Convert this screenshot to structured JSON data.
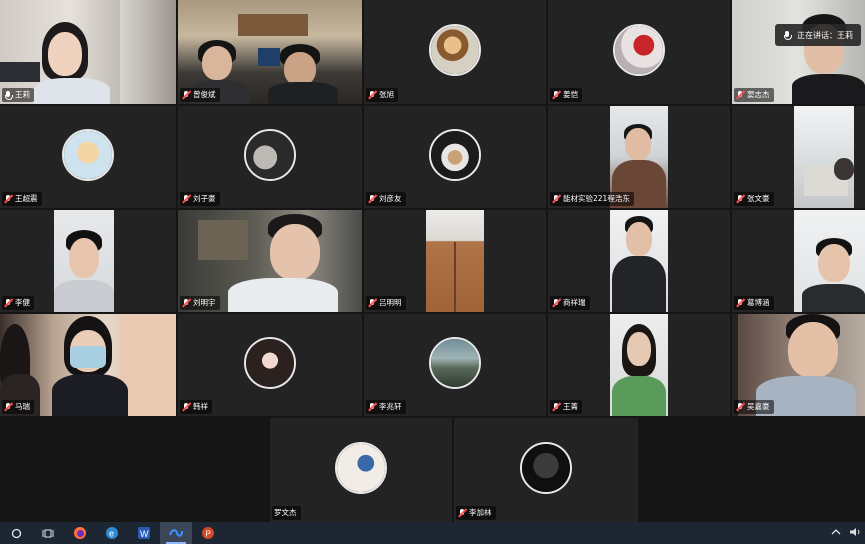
{
  "meeting": {
    "talking_banner": "正在讲话：王莉",
    "colors": {
      "speaking_border": "#5cbf3a",
      "tile_bg": "#232323",
      "nametag_bg": "rgba(0,0,0,0.55)",
      "muted_red": "#ff4d4d"
    }
  },
  "participants": [
    {
      "name": "王莉",
      "mic": "on",
      "type": "video",
      "speaking": true
    },
    {
      "name": "曾俊斌",
      "mic": "muted",
      "type": "video"
    },
    {
      "name": "张旭",
      "mic": "muted",
      "type": "avatar"
    },
    {
      "name": "姜恺",
      "mic": "muted",
      "type": "avatar"
    },
    {
      "name": "窦志杰",
      "mic": "muted",
      "type": "video"
    },
    {
      "name": "王超震",
      "mic": "muted",
      "type": "avatar"
    },
    {
      "name": "刘子豪",
      "mic": "muted",
      "type": "avatar"
    },
    {
      "name": "刘彦友",
      "mic": "muted",
      "type": "avatar"
    },
    {
      "name": "能材实验221程浩东",
      "mic": "muted",
      "type": "video"
    },
    {
      "name": "张文豪",
      "mic": "muted",
      "type": "video"
    },
    {
      "name": "李健",
      "mic": "muted",
      "type": "video"
    },
    {
      "name": "刘明宇",
      "mic": "muted",
      "type": "video"
    },
    {
      "name": "吕明明",
      "mic": "muted",
      "type": "video"
    },
    {
      "name": "商祥瑞",
      "mic": "muted",
      "type": "video"
    },
    {
      "name": "葛博涵",
      "mic": "muted",
      "type": "video"
    },
    {
      "name": "马瑞",
      "mic": "muted",
      "type": "video"
    },
    {
      "name": "韩祥",
      "mic": "muted",
      "type": "avatar"
    },
    {
      "name": "李兆轩",
      "mic": "muted",
      "type": "avatar"
    },
    {
      "name": "王菁",
      "mic": "muted",
      "type": "video"
    },
    {
      "name": "吴嘉豪",
      "mic": "muted",
      "type": "video"
    },
    {
      "name": "罗文杰",
      "mic": "none",
      "type": "avatar"
    },
    {
      "name": "李加林",
      "mic": "muted",
      "type": "avatar"
    }
  ],
  "taskbar": {
    "apps": [
      "start-icon",
      "search-icon",
      "task-view-icon",
      "firefox-icon",
      "edge-icon",
      "word-icon",
      "tencent-meeting-icon",
      "powerpoint-icon"
    ],
    "tray": [
      "chevron-up-icon",
      "speaker-icon"
    ]
  }
}
